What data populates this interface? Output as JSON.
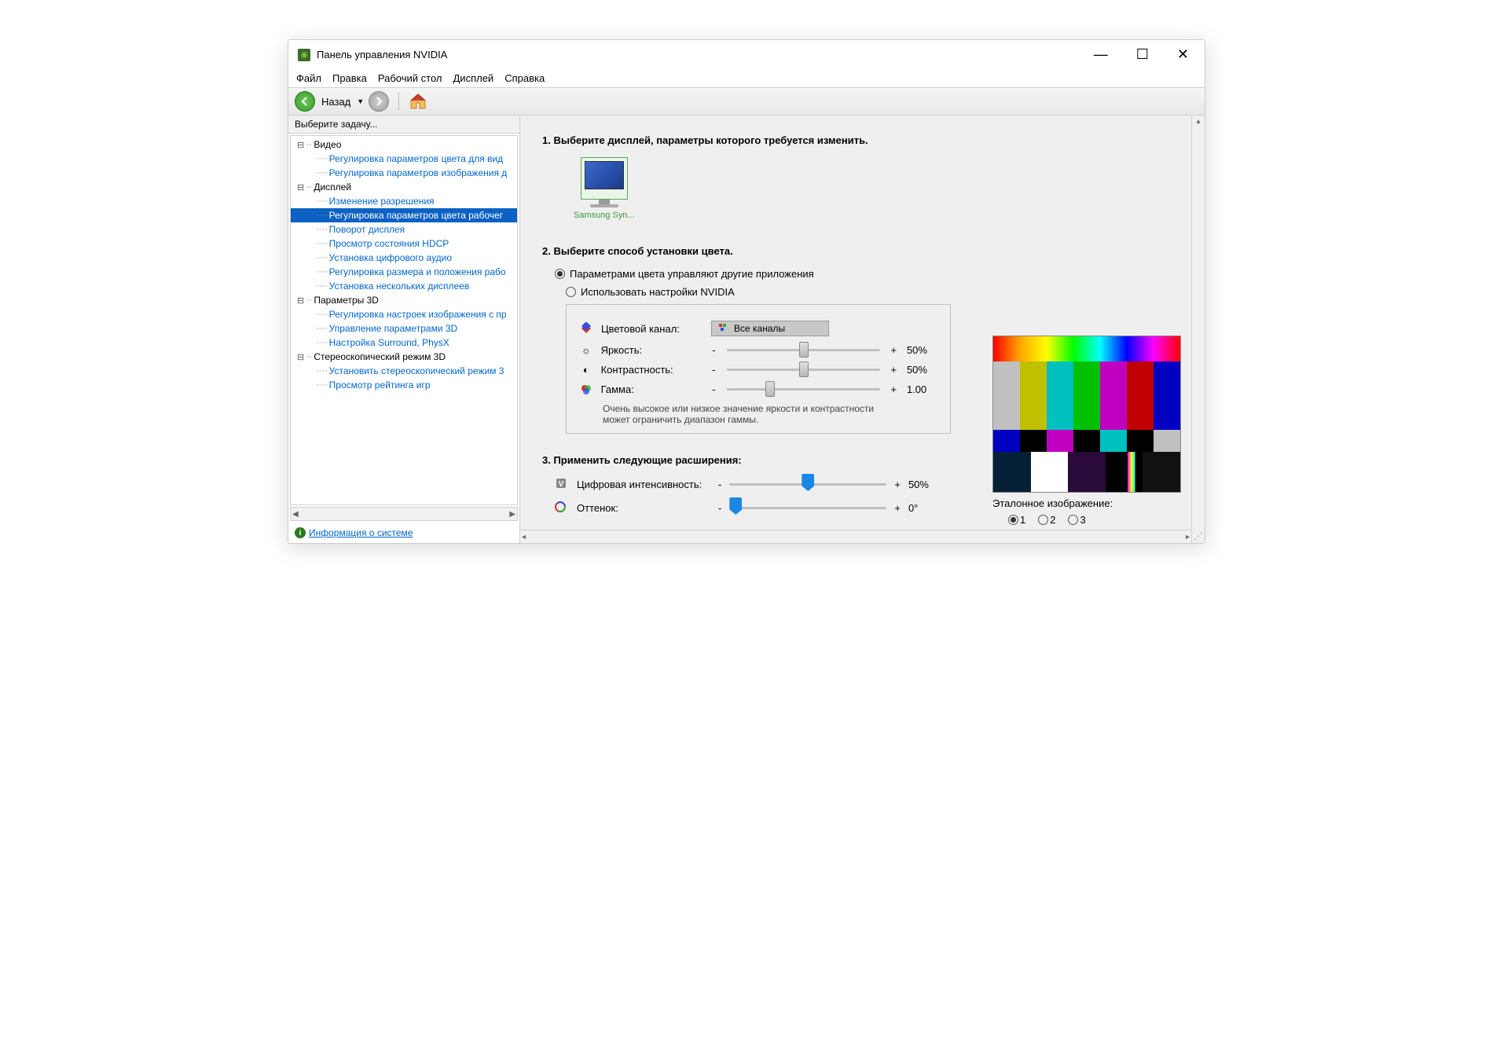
{
  "window": {
    "title": "Панель управления NVIDIA"
  },
  "menu": {
    "file": "Файл",
    "edit": "Правка",
    "desktop": "Рабочий стол",
    "display": "Дисплей",
    "help": "Справка"
  },
  "toolbar": {
    "back": "Назад"
  },
  "sidebar": {
    "header": "Выберите задачу...",
    "groups": [
      {
        "label": "Видео",
        "items": [
          "Регулировка параметров цвета для вид",
          "Регулировка параметров изображения д"
        ]
      },
      {
        "label": "Дисплей",
        "items": [
          "Изменение разрешения",
          "Регулировка параметров цвета рабочег",
          "Поворот дисплея",
          "Просмотр состояния HDCP",
          "Установка цифрового аудио",
          "Регулировка размера и положения рабо",
          "Установка нескольких дисплеев"
        ]
      },
      {
        "label": "Параметры 3D",
        "items": [
          "Регулировка настроек изображения с пр",
          "Управление параметрами 3D",
          "Настройка Surround, PhysX"
        ]
      },
      {
        "label": "Стереоскопический режим 3D",
        "items": [
          "Установить стереоскопический режим 3",
          "Просмотр рейтинга игр"
        ]
      }
    ],
    "selected": "Регулировка параметров цвета рабочег",
    "sysinfo": "Информация о системе"
  },
  "main": {
    "step1_title": "1. Выберите дисплей, параметры которого требуется изменить.",
    "display_name": "Samsung Syn...",
    "step2_title": "2. Выберите способ установки цвета.",
    "radio_other": "Параметрами цвета управляют другие приложения",
    "radio_nvidia": "Использовать настройки NVIDIA",
    "channel_label": "Цветовой канал:",
    "channel_value": "Все каналы",
    "brightness_label": "Яркость:",
    "brightness_value": "50%",
    "contrast_label": "Контрастность:",
    "contrast_value": "50%",
    "gamma_label": "Гамма:",
    "gamma_value": "1.00",
    "note": "Очень высокое или низкое значение яркости и контрастности может ограничить диапазон гаммы.",
    "step3_title": "3. Применить следующие расширения:",
    "vibrance_label": "Цифровая интенсивность:",
    "vibrance_value": "50%",
    "hue_label": "Оттенок:",
    "hue_value": "0°",
    "reference_label": "Эталонное изображение:",
    "ref_options": [
      "1",
      "2",
      "3"
    ],
    "minus": "-",
    "plus": "+"
  }
}
